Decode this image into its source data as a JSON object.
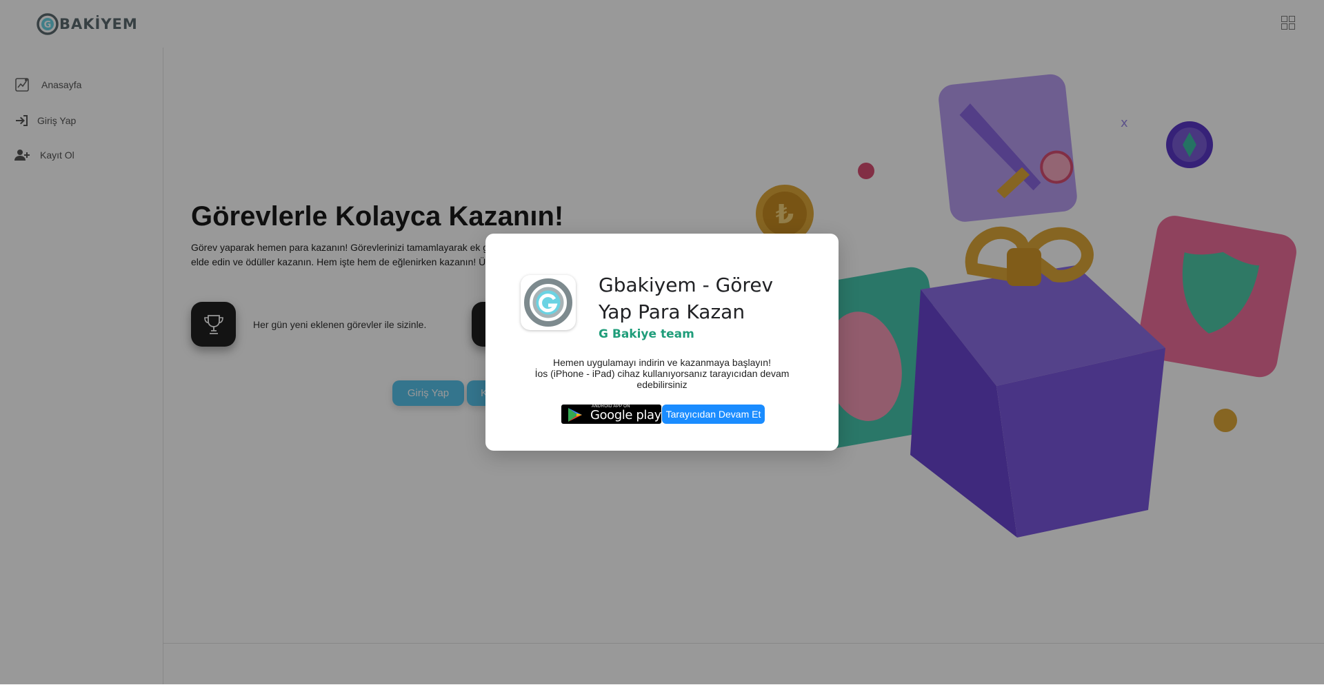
{
  "header": {
    "logo_text": "BAKİYEM",
    "logo_letter": "G",
    "menu_icon": "grid-icon"
  },
  "sidebar": {
    "items": [
      {
        "label": "Anasayfa",
        "icon": "chart-icon"
      },
      {
        "label": "Giriş Yap",
        "icon": "login-icon"
      },
      {
        "label": "Kayıt Ol",
        "icon": "user-plus-icon"
      }
    ]
  },
  "hero": {
    "title": "Görevlerle Kolayca Kazanın!",
    "description": "Görev yaparak hemen para kazanın! Görevlerinizi tamamlayarak ek gelir elde edin ve ödüller kazanın. Hem işte hem de eğlenirken kazanın! Ücretsiz kaydolun.",
    "features": [
      {
        "icon": "trophy-icon",
        "text": "Her gün yeni eklenen görevler ile sizinle."
      },
      {
        "icon": "task-icon",
        "text": ""
      }
    ],
    "buttons": {
      "login": "Giriş Yap",
      "register": "K"
    },
    "currency_symbol": "₺"
  },
  "modal": {
    "app_name": "Gbakiyem - Görev Yap Para Kazan",
    "developer": "G Bakiye team",
    "message_line1": "Hemen uygulamayı indirin ve kazanmaya başlayın!",
    "message_line2": "İos (iPhone - iPad) cihaz kullanıyorsanız tarayıcıdan devam edebilirsiniz",
    "google_play_small": "ANDROID APP ON",
    "google_play_big": "Google play",
    "browser_button": "Tarayıcıdan Devam Et"
  },
  "colors": {
    "accent_blue": "#1a8cff",
    "hero_button": "#58c3ec",
    "developer_green": "#1f9d7a",
    "gift_purple": "#7b5cd6"
  }
}
